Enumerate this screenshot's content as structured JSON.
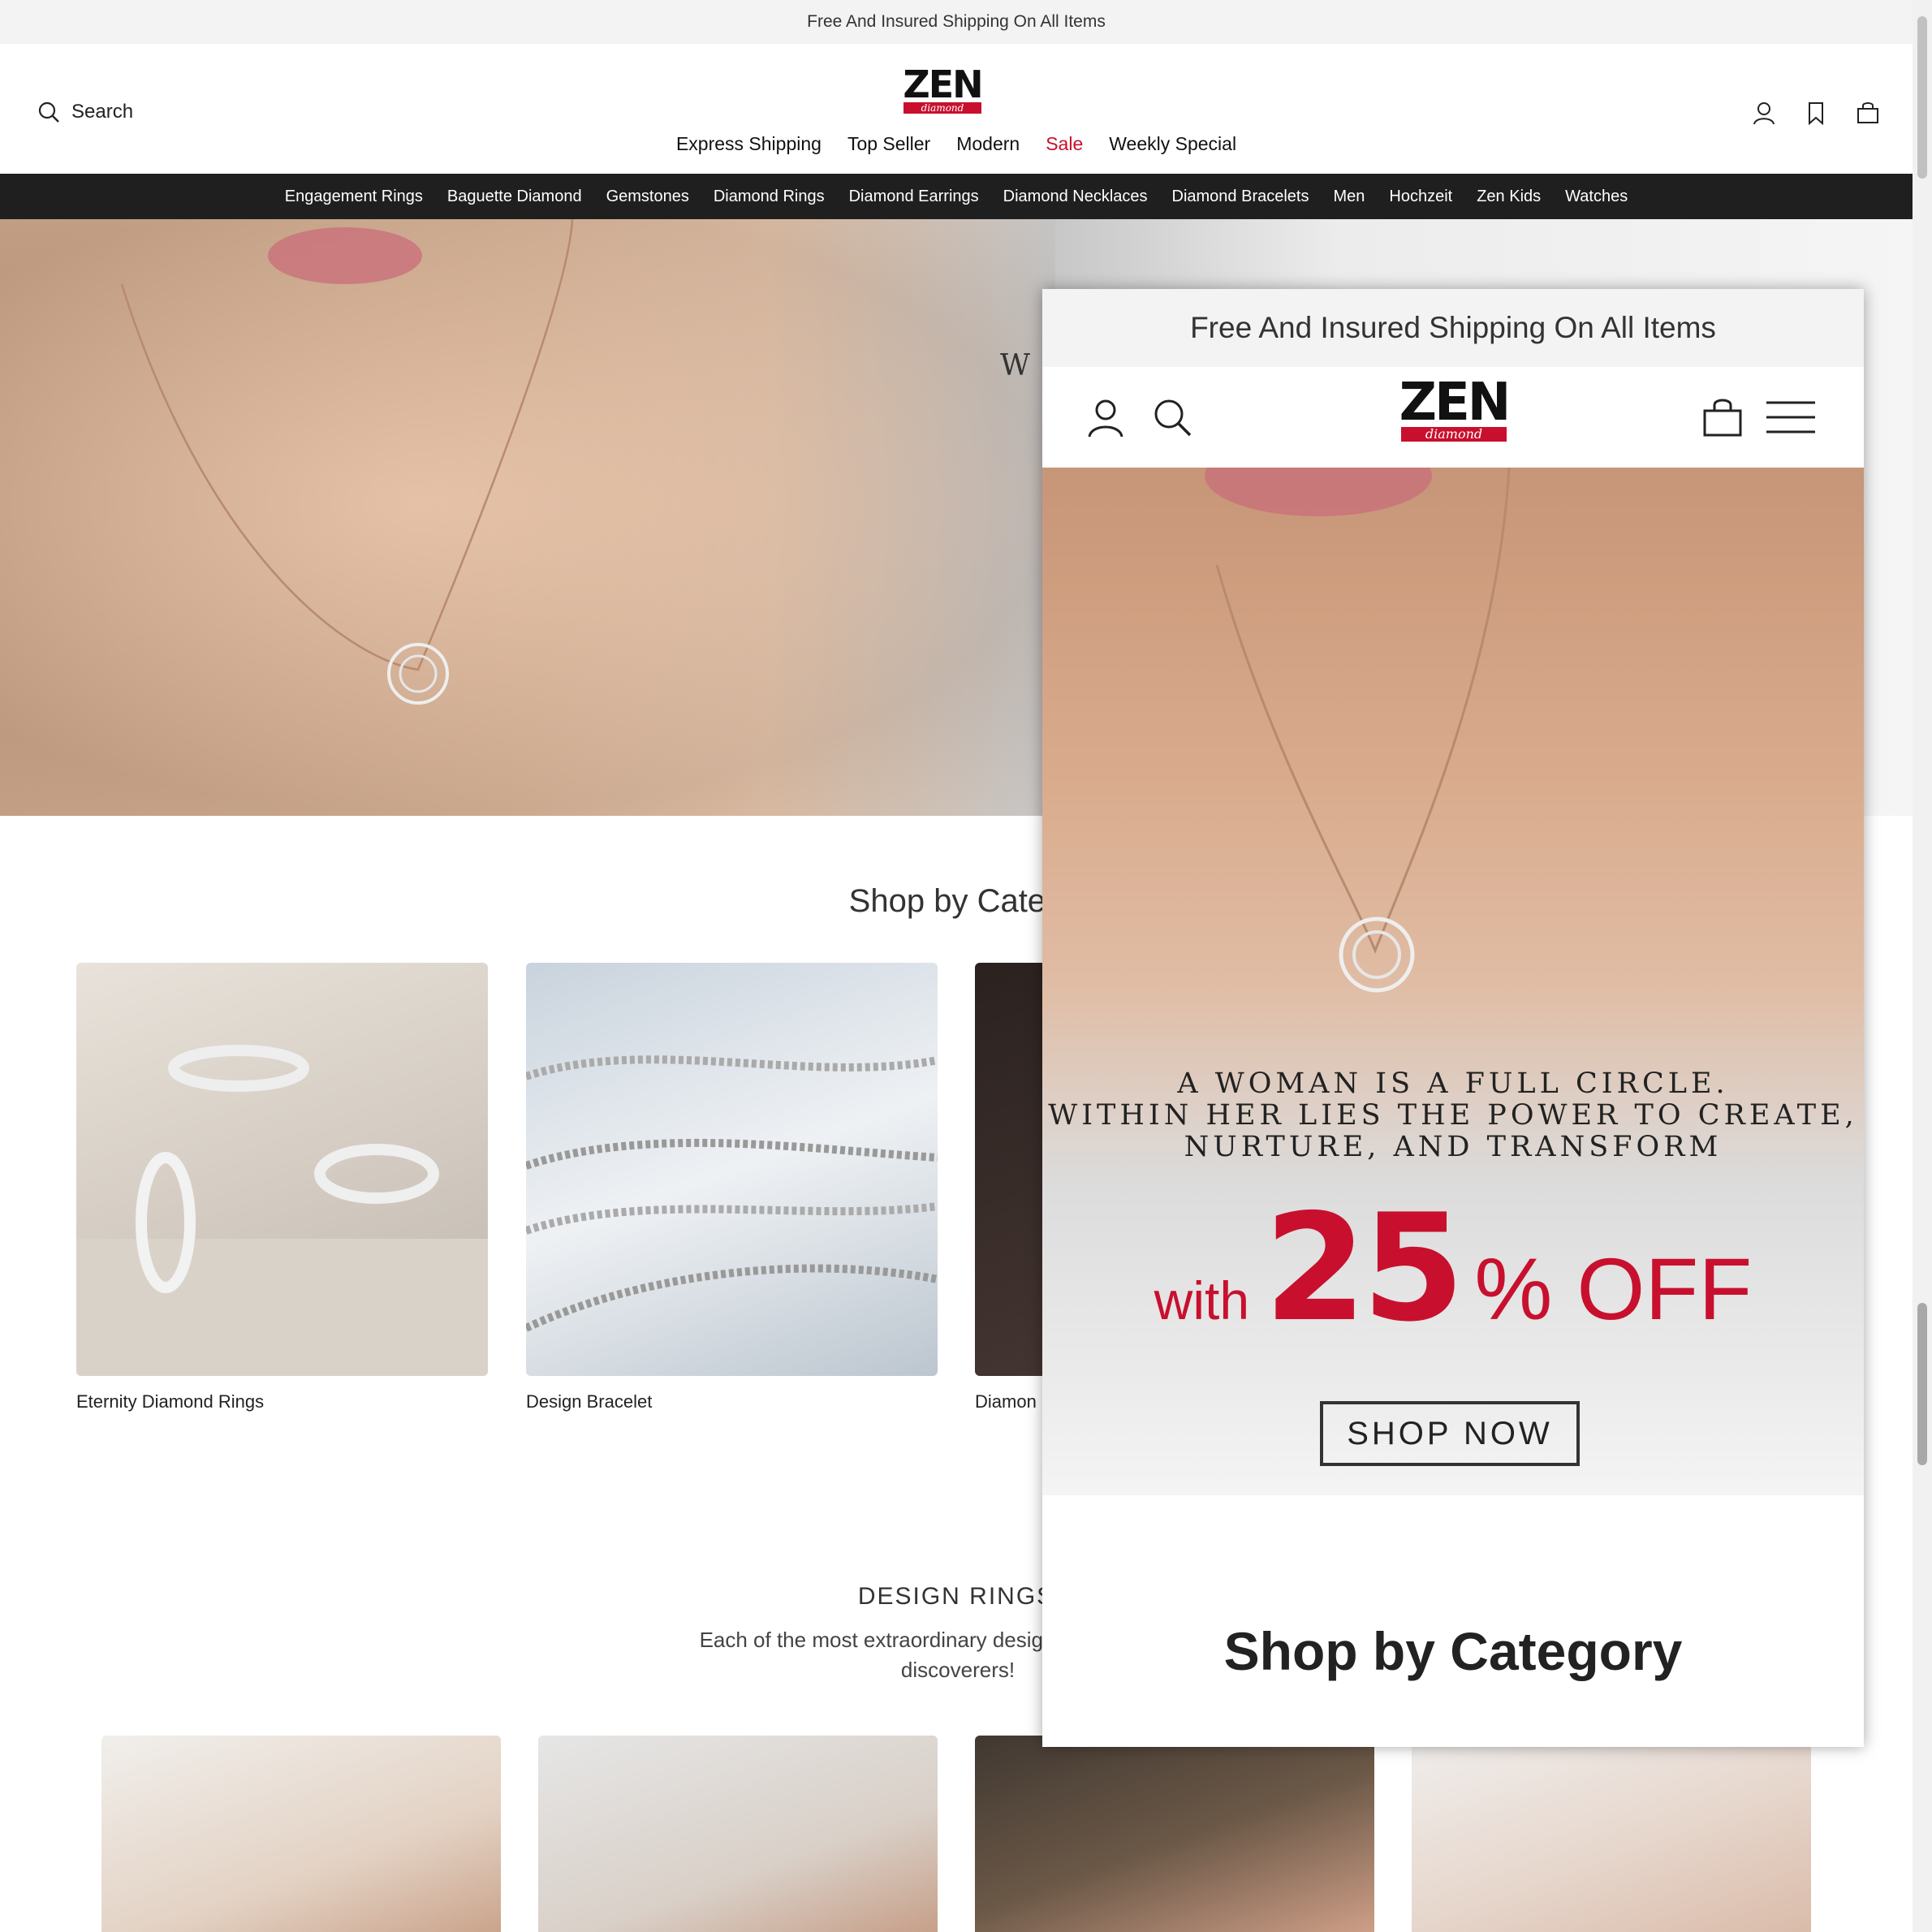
{
  "announcement": "Free And Insured Shipping On All Items",
  "search": {
    "label": "Search"
  },
  "logo": {
    "brand": "ZEN",
    "sub": "diamond"
  },
  "topnav": [
    {
      "label": "Express Shipping"
    },
    {
      "label": "Top Seller"
    },
    {
      "label": "Modern"
    },
    {
      "label": "Sale"
    },
    {
      "label": "Weekly Special"
    }
  ],
  "categories": [
    "Engagement Rings",
    "Baguette Diamond",
    "Gemstones",
    "Diamond Rings",
    "Diamond Earrings",
    "Diamond Necklaces",
    "Diamond Bracelets",
    "Men",
    "Hochzeit",
    "Zen Kids",
    "Watches"
  ],
  "hero": {
    "partial_text": "W"
  },
  "shop_by_category": {
    "title": "Shop by Categ",
    "cards": [
      {
        "label": "Eternity Diamond Rings"
      },
      {
        "label": "Design Bracelet"
      },
      {
        "label": "Diamon"
      }
    ]
  },
  "design_rings": {
    "title": "DESIGN RINGS",
    "desc_line1": "Each of the most extraordinary design rings has a differ",
    "desc_line2": "discoverers!"
  },
  "mobile": {
    "announcement": "Free And Insured Shipping On All Items",
    "quote_line1": "A WOMAN IS A FULL CIRCLE.",
    "quote_line2": "WITHIN HER LIES THE POWER TO CREATE,",
    "quote_line3": "NURTURE, AND TRANSFORM",
    "offer_with": "with",
    "offer_number": "25",
    "offer_rest": "% OFF",
    "cta": "SHOP NOW",
    "section_title": "Shop by Category"
  },
  "colors": {
    "accent": "#c8102e",
    "catbar": "#1f1f1f",
    "announce_bg": "#f3f3f3"
  }
}
